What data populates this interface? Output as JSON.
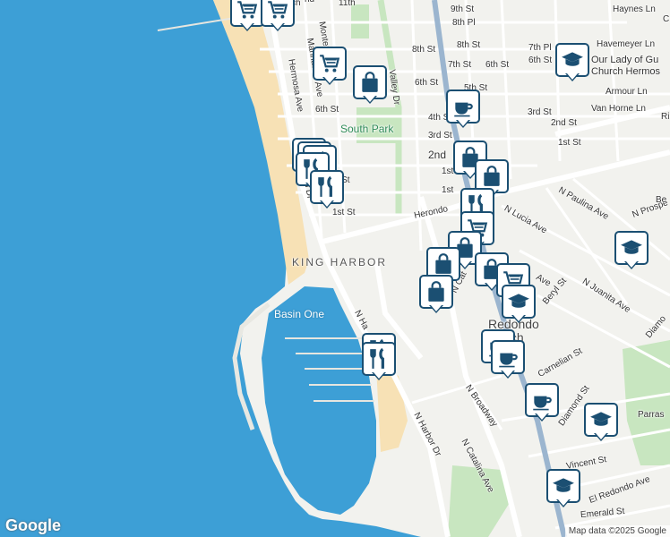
{
  "map": {
    "colors": {
      "water": "#3d9fd6",
      "land": "#f2f2ee",
      "beach": "#f7e1b5",
      "park": "#c8e6c0",
      "road": "#ffffff",
      "highway": "#9bb5cf",
      "marker": "#1b4f72"
    },
    "labels": {
      "hermosa_ave": "Hermosa Ave",
      "manhattan_ave": "Manhattan Ave",
      "monterey": "Monter",
      "valley_dr": "Valley Dr",
      "south_park": "South Park",
      "king_harbor": "KING HARBOR",
      "basin_one": "Basin One",
      "n_harbor_dr_upper": "N Ha",
      "n_harbor_dr": "N Harbor Dr",
      "herondo": "Herondo",
      "redondo_beach": "Redondo Beach",
      "n_catalina_ave": "N Catalina Ave",
      "n_catalina_short": "N Cat",
      "n_broadway": "N Broadway",
      "n_paulina_ave": "N Paulina Ave",
      "n_lucia_ave": "N Lucia Ave",
      "n_juanita_ave": "N Juanita Ave",
      "n_prospect": "N Prospe",
      "beryl_st": "Beryl St",
      "carnelian_st": "Carnelian St",
      "diamond_st": "Diamond St",
      "diamo": "Diamo",
      "vincent_st": "Vincent St",
      "el_redondo_ave": "El Redondo Ave",
      "emerald_st": "Emerald St",
      "parras": "Parras",
      "haynes_ln": "Haynes Ln",
      "havemeyer_ln": "Havemeyer Ln",
      "armour_ln": "Armour Ln",
      "van_horne_ln": "Van Horne Ln",
      "our_lady": "Our Lady of Gu",
      "church_hermosa": "Church Hermos",
      "st_9th": "9th St",
      "pl_8th": "8th Pl",
      "st_8th": "8th St",
      "st_8th_b": "8th St",
      "pl_7th": "7th Pl",
      "st_7th": "7th St",
      "st_6th": "6th St",
      "st_6th_b": "6th St",
      "st_6th_c": "6th St",
      "st_6th_d": "6th St",
      "st_5th": "5th St",
      "st_4th": "4th St",
      "st_3rd": "3rd St",
      "st_3rd_b": "3rd St",
      "st_2nd": "2nd St",
      "st_2nd_b": "2nd",
      "st_1st": "1st St",
      "st_1st_b": "1st St",
      "st_1st_c": "1st",
      "st_1st_d": "1st",
      "st_1st_e": "1st St",
      "st_11th": "11th",
      "sh_dr": "sh Dr",
      "ave_r": "Ave",
      "be": "Be",
      "rip": "Ri",
      "c_half": "C",
      "bch_top": "ch",
      "nd_top": "nd"
    }
  },
  "markers": [
    {
      "icon": "shopping-cart-icon"
    },
    {
      "icon": "shopping-cart-icon"
    },
    {
      "icon": "shopping-cart-icon"
    },
    {
      "icon": "shopping-bag-icon"
    },
    {
      "icon": "school-icon"
    },
    {
      "icon": "coffee-cup-icon"
    },
    {
      "icon": "restaurant-icon"
    },
    {
      "icon": "restaurant-icon"
    },
    {
      "icon": "restaurant-icon"
    },
    {
      "icon": "restaurant-icon"
    },
    {
      "icon": "restaurant-icon"
    },
    {
      "icon": "shopping-bag-icon"
    },
    {
      "icon": "shopping-bag-icon"
    },
    {
      "icon": "restaurant-icon"
    },
    {
      "icon": "shopping-cart-icon"
    },
    {
      "icon": "shopping-bag-icon"
    },
    {
      "icon": "shopping-bag-icon"
    },
    {
      "icon": "shopping-bag-icon"
    },
    {
      "icon": "shopping-bag-icon"
    },
    {
      "icon": "shopping-cart-icon"
    },
    {
      "icon": "school-icon"
    },
    {
      "icon": "school-icon"
    },
    {
      "icon": "coffee-cup-icon"
    },
    {
      "icon": "coffee-cup-icon"
    },
    {
      "icon": "coffee-cup-icon"
    },
    {
      "icon": "restaurant-icon"
    },
    {
      "icon": "restaurant-icon"
    },
    {
      "icon": "school-icon"
    },
    {
      "icon": "school-icon"
    }
  ],
  "attribution": {
    "logo": "Google",
    "text": "Map data ©2025 Google"
  }
}
